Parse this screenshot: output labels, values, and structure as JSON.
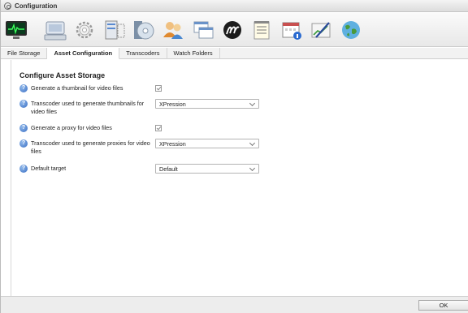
{
  "window": {
    "title": "Configuration"
  },
  "toolbar": {
    "icons": [
      "monitor-icon",
      "keyboard-icon",
      "gear-icon",
      "storage-rack-icon",
      "media-disc-icon",
      "users-icon",
      "windows-icon",
      "xpression-logo-icon",
      "document-list-icon",
      "calendar-info-icon",
      "chart-edit-icon",
      "globe-icon"
    ]
  },
  "tabs": [
    {
      "label": "File Storage",
      "active": false
    },
    {
      "label": "Asset Configuration",
      "active": true
    },
    {
      "label": "Transcoders",
      "active": false
    },
    {
      "label": "Watch Folders",
      "active": false
    }
  ],
  "content": {
    "heading": "Configure Asset Storage",
    "rows": [
      {
        "label": "Generate a thumbnail for video files",
        "control": "checkbox",
        "checked": true
      },
      {
        "label": "Transcoder used to generate thumbnails for video files",
        "control": "select",
        "value": "XPression"
      },
      {
        "label": "Generate a proxy for video files",
        "control": "checkbox",
        "checked": true
      },
      {
        "label": "Transcoder used to generate proxies for video files",
        "control": "select",
        "value": "XPression"
      },
      {
        "label": "Default target",
        "control": "select",
        "value": "Default"
      }
    ]
  },
  "footer": {
    "ok_label": "OK"
  },
  "colors": {
    "help_icon": "#3a6fc4",
    "toolbar_bg": "#eeeeee"
  }
}
